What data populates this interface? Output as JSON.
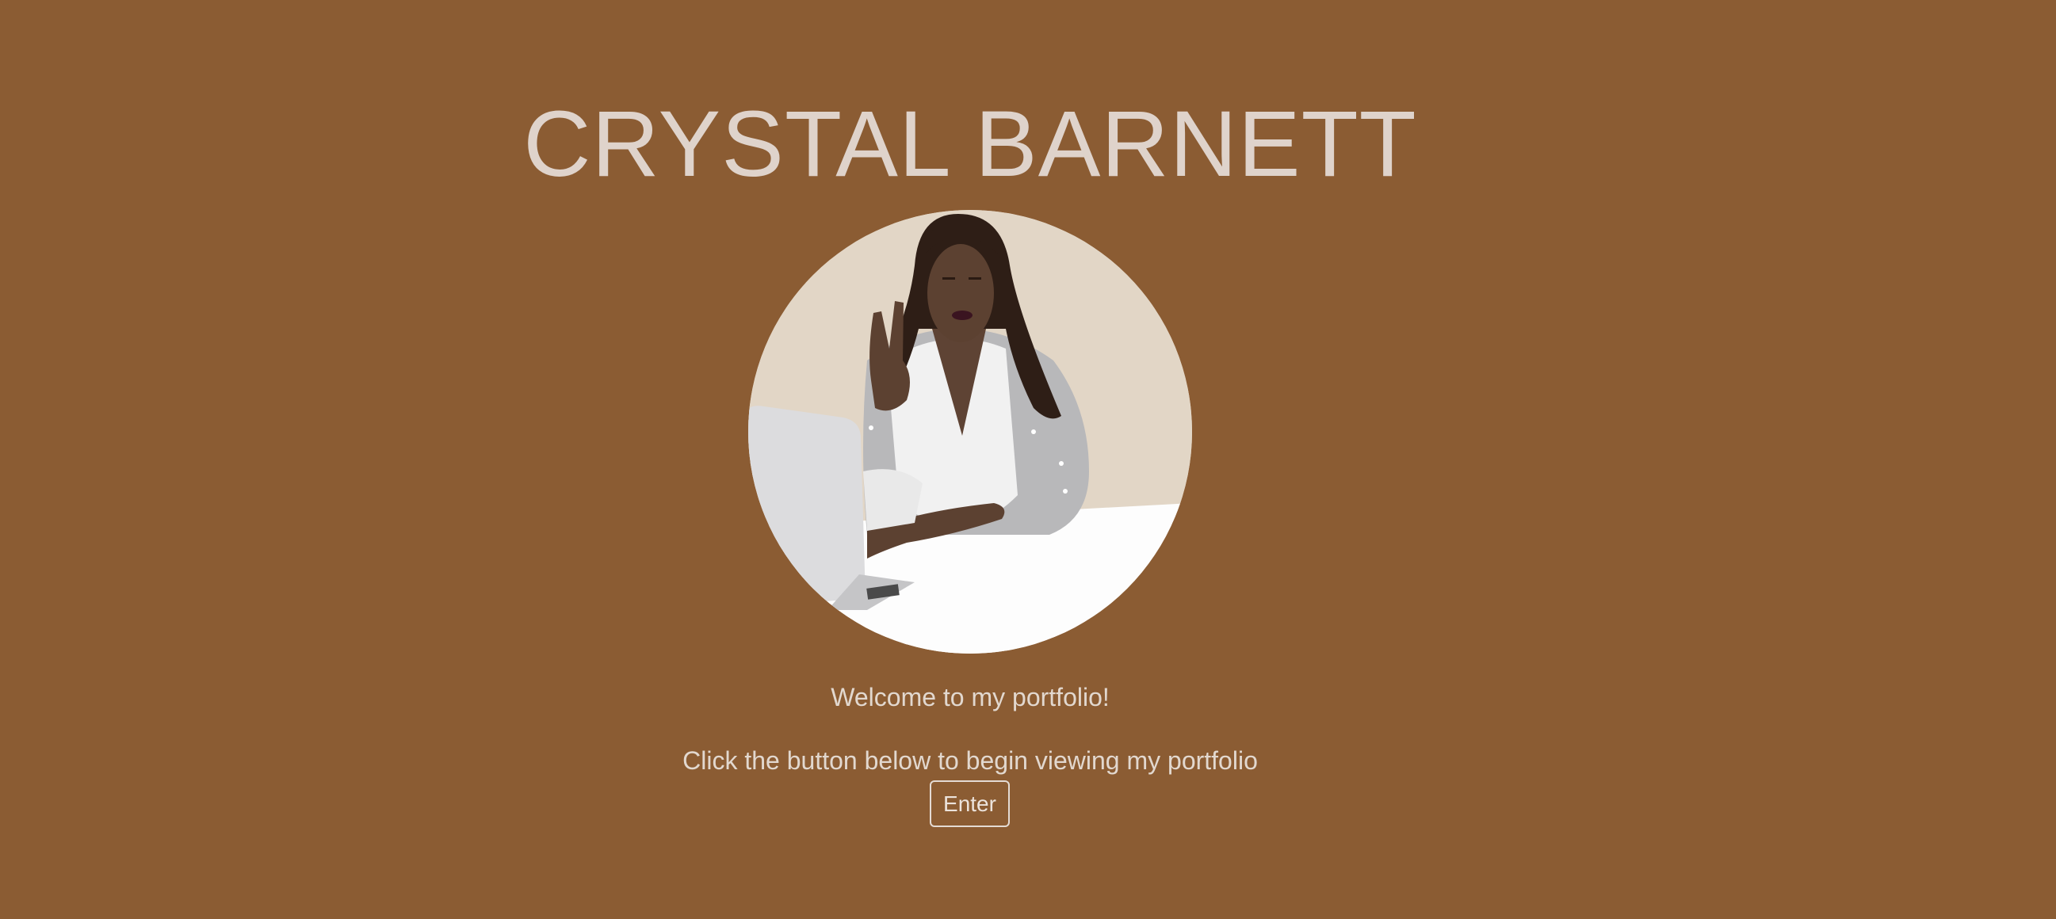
{
  "header": {
    "title": "CRYSTAL BARNETT"
  },
  "hero": {
    "avatar_description_icon": "illustrated-portrait",
    "welcome": "Welcome to my portfolio!",
    "instruction": "Click the button below to begin viewing my portfolio"
  },
  "actions": {
    "enter_label": "Enter"
  },
  "colors": {
    "background": "#8b5c33",
    "text": "#dfd3cb",
    "avatar_backdrop": "#e2d6c6",
    "button_border": "#e4dbd4"
  }
}
